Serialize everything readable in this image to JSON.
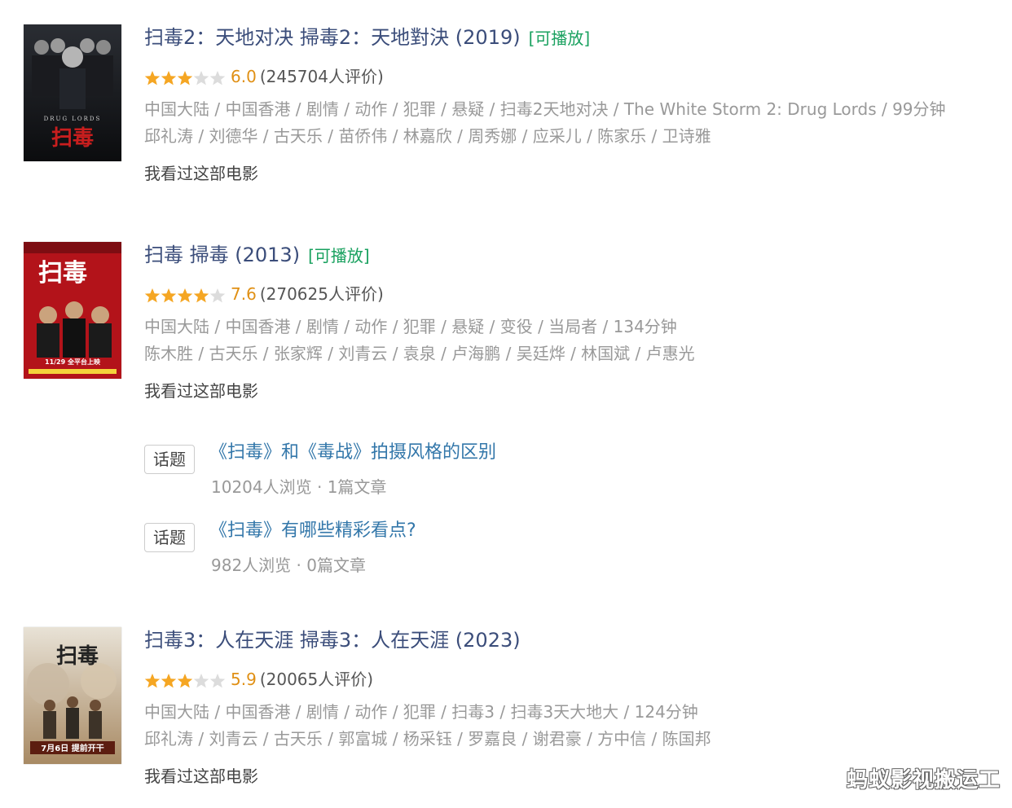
{
  "movies": [
    {
      "title": "扫毒2：天地对决 掃毒2：天地對決 (2019)",
      "playable": "[可播放]",
      "stars": 3,
      "score": "6.0",
      "count": "(245704人评价)",
      "meta1": "中国大陆 / 中国香港 / 剧情 / 动作 / 犯罪 / 悬疑 / 扫毒2天地对决 / The White Storm 2: Drug Lords / 99分钟",
      "meta2": "邱礼涛 / 刘德华 / 古天乐 / 苗侨伟 / 林嘉欣 / 周秀娜 / 应采儿 / 陈家乐 / 卫诗雅",
      "seen": "我看过这部电影",
      "poster_text": "DRUG LORDS"
    },
    {
      "title": "扫毒 掃毒 (2013)",
      "playable": "[可播放]",
      "stars": 4,
      "score": "7.6",
      "count": "(270625人评价)",
      "meta1": "中国大陆 / 中国香港 / 剧情 / 动作 / 犯罪 / 悬疑 / 变役 / 当局者 / 134分钟",
      "meta2": "陈木胜 / 古天乐 / 张家辉 / 刘青云 / 袁泉 / 卢海鹏 / 吴廷烨 / 林国斌 / 卢惠光",
      "seen": "我看过这部电影",
      "poster_text": "11/29 全平台上映"
    },
    {
      "title": "扫毒3：人在天涯 掃毒3：人在天涯 (2023)",
      "playable": "",
      "stars": 3,
      "score": "5.9",
      "count": "(20065人评价)",
      "meta1": "中国大陆 / 中国香港 / 剧情 / 动作 / 犯罪 / 扫毒3 / 扫毒3天大地大 / 124分钟",
      "meta2": "邱礼涛 / 刘青云 / 古天乐 / 郭富城 / 杨采钰 / 罗嘉良 / 谢君豪 / 方中信 / 陈国邦",
      "seen": "我看过这部电影",
      "poster_text": "7月6日 提前开干"
    }
  ],
  "topics": [
    {
      "tag": "话题",
      "title": "《扫毒》和《毒战》拍摄风格的区别",
      "sub": "10204人浏览 · 1篇文章"
    },
    {
      "tag": "话题",
      "title": "《扫毒》有哪些精彩看点?",
      "sub": "982人浏览 · 0篇文章"
    }
  ],
  "watermark": "蚂蚁影视搬运工",
  "colors": {
    "title": "#3b4d7a",
    "playable": "#19a15f",
    "score": "#e09015",
    "star": "#f5a623",
    "link": "#3377aa"
  }
}
